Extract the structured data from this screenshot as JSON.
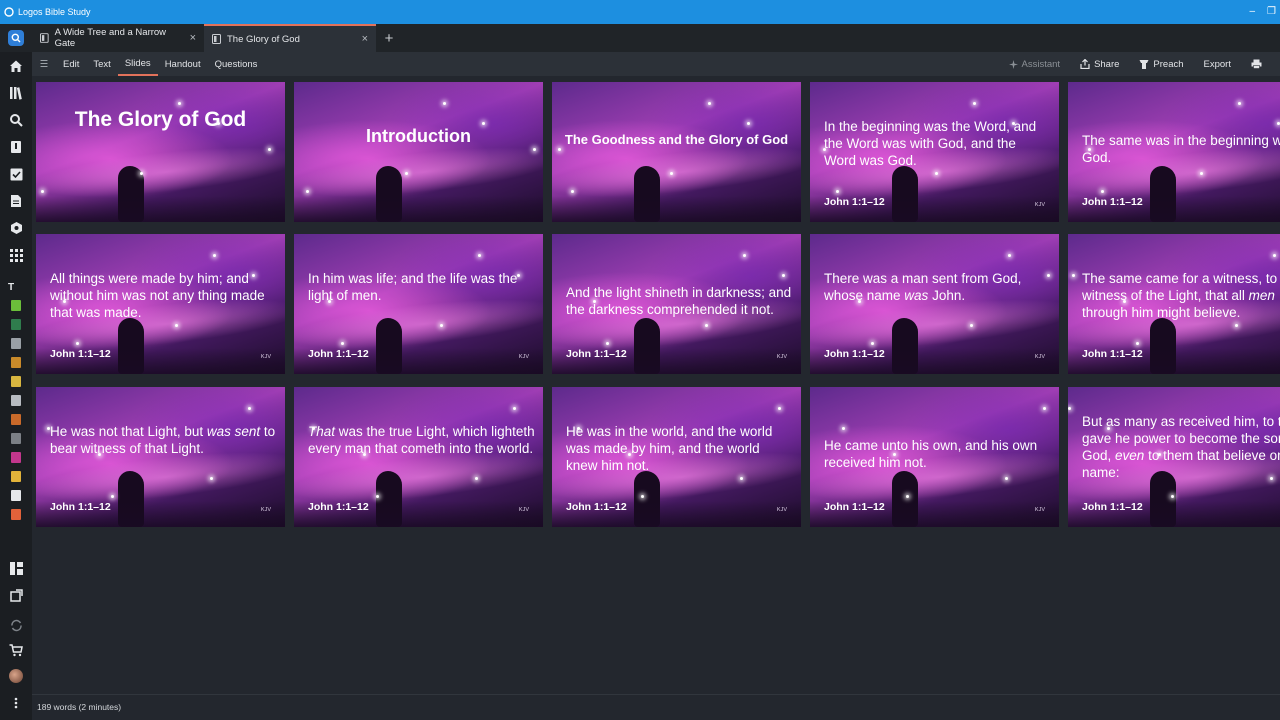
{
  "window": {
    "title": "Logos Bible Study",
    "minimize": "–",
    "restore": "❐"
  },
  "tabs": [
    {
      "label": "A Wide Tree and a Narrow Gate",
      "active": false
    },
    {
      "label": "The Glory of God",
      "active": true
    }
  ],
  "tab_close": "×",
  "tab_add": "+",
  "toolbar": {
    "menu_icon": "☰",
    "left": [
      "Edit",
      "Text",
      "Slides",
      "Handout",
      "Questions"
    ],
    "active": "Slides",
    "assistant": "Assistant",
    "share": "Share",
    "preach": "Preach",
    "export": "Export"
  },
  "sidebar": {
    "letter": "T"
  },
  "slides": [
    {
      "type": "title",
      "title": "The Glory of God"
    },
    {
      "type": "title",
      "title": "Introduction"
    },
    {
      "type": "title",
      "title": "The Goodness and the Glory of God"
    },
    {
      "type": "verse",
      "html": "In the beginning was the Word, and the Word was with God, and the Word was God.",
      "ref": "John 1:1–12",
      "ver": "KJV"
    },
    {
      "type": "verse",
      "html": "The same was in the beginning with God.",
      "ref": "John 1:1–12",
      "ver": "KJV"
    },
    {
      "type": "verse",
      "html": "All things were made by him; and without him was not any thing made that was made.",
      "ref": "John 1:1–12",
      "ver": "KJV"
    },
    {
      "type": "verse",
      "html": "In him was life; and the life was the light of men.",
      "ref": "John 1:1–12",
      "ver": "KJV"
    },
    {
      "type": "verse",
      "html": "And the light shineth in darkness; and the darkness comprehended it not.",
      "ref": "John 1:1–12",
      "ver": "KJV"
    },
    {
      "type": "verse",
      "html": "There was a man sent from God, whose name <i>was</i> John.",
      "ref": "John 1:1–12",
      "ver": "KJV"
    },
    {
      "type": "verse",
      "html": "The same came for a witness, to bear witness of the Light, that all <i>men</i> through him might believe.",
      "ref": "John 1:1–12",
      "ver": "KJV"
    },
    {
      "type": "verse",
      "html": "He was not that Light, but <i>was sent</i> to bear witness of that Light.",
      "ref": "John 1:1–12",
      "ver": "KJV"
    },
    {
      "type": "verse",
      "html": "<i>That</i> was the true Light, which lighteth every man that cometh into the world.",
      "ref": "John 1:1–12",
      "ver": "KJV"
    },
    {
      "type": "verse",
      "html": "He was in the world, and the world was made by him, and the world knew him not.",
      "ref": "John 1:1–12",
      "ver": "KJV"
    },
    {
      "type": "verse",
      "html": "He came unto his own, and his own received him not.",
      "ref": "John 1:1–12",
      "ver": "KJV"
    },
    {
      "type": "verse",
      "html": "But as many as received him, to them gave he power to become the sons of God, <i>even</i> to them that believe on his name:",
      "ref": "John 1:1–12",
      "ver": "KJV"
    }
  ],
  "status": {
    "word_count": "189 words (2 minutes)"
  }
}
